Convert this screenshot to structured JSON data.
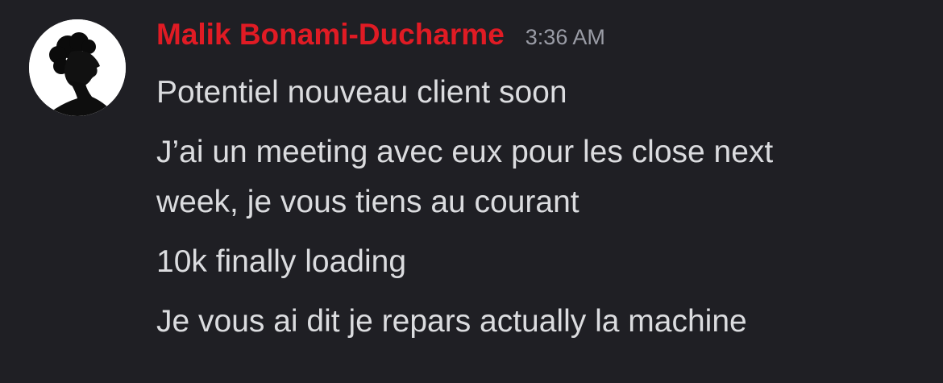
{
  "author": {
    "name": "Malik Bonami-Ducharme",
    "name_color": "#e01b24",
    "avatar_icon": "avatar-silhouette-profile-icon"
  },
  "timestamp": "3:36 AM",
  "messages": [
    "Potentiel nouveau client soon",
    "J’ai un meeting avec eux pour les close next\nweek, je vous tiens au courant",
    "10k finally loading",
    "Je vous ai dit je repars actually la machine"
  ],
  "theme": {
    "background": "#1f1f24",
    "text": "#dbdcdf",
    "muted": "#9a9ca6"
  }
}
